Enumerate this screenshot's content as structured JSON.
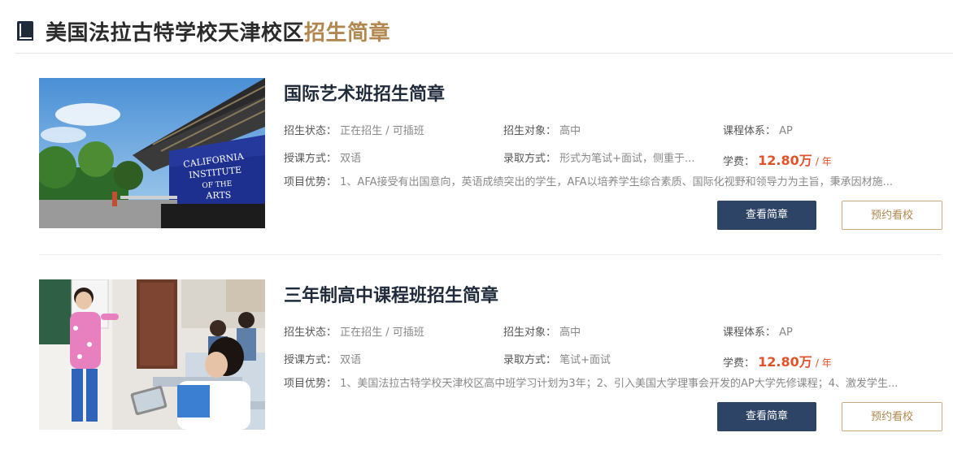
{
  "header": {
    "icon": "book-icon",
    "title": "美国法拉古特学校天津校区",
    "accent": "招生简章",
    "accent_color": "#b1874f"
  },
  "programs": [
    {
      "title": "国际艺术班招生简章",
      "image": "campus-photo",
      "image_text": [
        "CALIFORNIA",
        "INSTITUTE",
        "OF THE",
        "ARTS"
      ],
      "status_label": "招生状态：",
      "status_value": "正在招生 / 可插班",
      "target_label": "招生对象：",
      "target_value": "高中",
      "curriculum_label": "课程体系：",
      "curriculum_value": "AP",
      "teaching_label": "授课方式：",
      "teaching_value": "双语",
      "admission_label": "录取方式：",
      "admission_value": "形式为笔试+面试，侧重于...",
      "fee_label": "学费：",
      "fee_value": "12.80万",
      "fee_unit": "/ 年",
      "advantage_label": "项目优势：",
      "advantage_value": "1、AFA接受有出国意向，英语成绩突出的学生，AFA以培养学生综合素质、国际化视野和领导力为主旨，秉承因材施...",
      "view_button": "查看简章",
      "visit_button": "预约看校"
    },
    {
      "title": "三年制高中课程班招生简章",
      "image": "classroom-photo",
      "status_label": "招生状态：",
      "status_value": "正在招生 / 可插班",
      "target_label": "招生对象：",
      "target_value": "高中",
      "curriculum_label": "课程体系：",
      "curriculum_value": "AP",
      "teaching_label": "授课方式：",
      "teaching_value": "双语",
      "admission_label": "录取方式：",
      "admission_value": "笔试+面试",
      "fee_label": "学费：",
      "fee_value": "12.80万",
      "fee_unit": "/ 年",
      "advantage_label": "项目优势：",
      "advantage_value": "1、美国法拉古特学校天津校区高中班学习计划为3年；2、引入美国大学理事会开发的AP大学先修课程；4、激发学生...",
      "view_button": "查看简章",
      "visit_button": "预约看校"
    }
  ],
  "colors": {
    "primary_button": "#2e4467",
    "price": "#e0532a",
    "title": "#1f2a3a"
  }
}
